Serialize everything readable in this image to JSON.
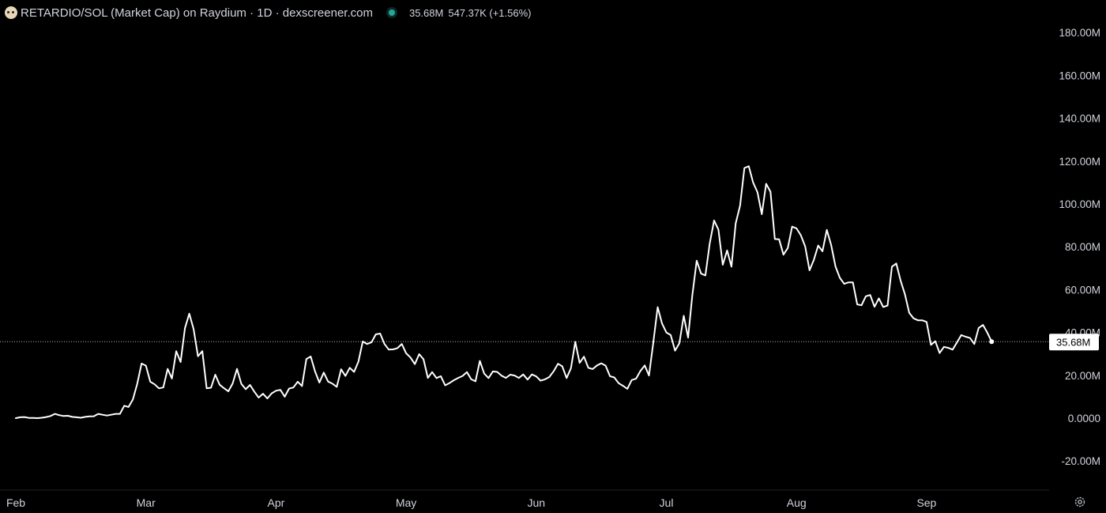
{
  "header": {
    "title": "RETARDIO/SOL (Market Cap) on Raydium · 1D · dexscreener.com",
    "value": "35.68M",
    "change": "547.37K (+1.56%)",
    "status_color": "#26a69a"
  },
  "icons": [
    "token-logo-icon",
    "status-dot-icon",
    "settings-gear-icon"
  ],
  "chart_data": {
    "type": "line",
    "series_color": "#ffffff",
    "background": "#000000",
    "ylim": [
      -20,
      180
    ],
    "y_ticks": [
      "180.00M",
      "160.00M",
      "140.00M",
      "120.00M",
      "100.00M",
      "80.00M",
      "60.00M",
      "40.00M",
      "20.00M",
      "0.0000",
      "-20.00M"
    ],
    "y_tick_values": [
      180,
      160,
      140,
      120,
      100,
      80,
      60,
      40,
      20,
      0,
      -20
    ],
    "x_ticks": [
      "Feb",
      "Mar",
      "Apr",
      "May",
      "Jun",
      "Jul",
      "Aug",
      "Sep"
    ],
    "x_tick_day_index": [
      0,
      30,
      60,
      90,
      120,
      150,
      180,
      210
    ],
    "first_date": "Feb 1",
    "grid": false,
    "last_value": 35.68,
    "last_value_label": "35.68M",
    "values": [
      0,
      0.4,
      0.5,
      0.1,
      0.1,
      0,
      0.2,
      0.5,
      1,
      2,
      1.4,
      1,
      1.1,
      0.6,
      0.4,
      0.2,
      0.6,
      0.8,
      0.9,
      2,
      1.6,
      1.2,
      1.6,
      2,
      2,
      5.8,
      5.2,
      8.7,
      16,
      25.5,
      24.5,
      17,
      15.8,
      13.9,
      14.3,
      23,
      18.5,
      31.3,
      26.2,
      42,
      48.8,
      41.5,
      28.9,
      31.3,
      13.9,
      14.2,
      20.3,
      15.6,
      14,
      12.5,
      16.2,
      23,
      16,
      13.5,
      15.5,
      12.4,
      9.6,
      11.4,
      9.2,
      11.6,
      12.8,
      13.2,
      10,
      13.8,
      14.3,
      17,
      15,
      27.6,
      28.8,
      21.8,
      16.6,
      21.3,
      17.1,
      16.1,
      14.6,
      22.8,
      19.7,
      23.5,
      21.6,
      26.4,
      35.8,
      34.6,
      35.4,
      39.1,
      39.5,
      34.6,
      32,
      32.1,
      32.7,
      34.6,
      30.3,
      28.3,
      25.2,
      29.9,
      27.5,
      18.8,
      21.5,
      18.7,
      19.6,
      15.3,
      16.4,
      17.7,
      18.8,
      19.7,
      21.5,
      18.1,
      17.2,
      26.7,
      20.8,
      18.7,
      21.8,
      21.6,
      19.8,
      18.8,
      20.3,
      19.9,
      18.8,
      20.4,
      18,
      20.4,
      19.5,
      17.5,
      18.1,
      19.2,
      21.9,
      25.4,
      24.2,
      18.7,
      23.3,
      35.6,
      25.8,
      28.7,
      23.5,
      22.9,
      24.6,
      25.6,
      24.5,
      19.6,
      19,
      16.3,
      15.1,
      13.7,
      17.8,
      18.4,
      22,
      24.6,
      19.9,
      35.4,
      51.8,
      44.2,
      40,
      38.8,
      31.5,
      35,
      47.8,
      37.6,
      57.5,
      73.5,
      67.5,
      66.6,
      81.6,
      92.3,
      88,
      71.6,
      78.3,
      70.7,
      91,
      99.2,
      116.8,
      117.6,
      110,
      105.5,
      95.2,
      109.4,
      105.7,
      83.6,
      83.5,
      76.3,
      79.4,
      89.4,
      88.6,
      85.4,
      80.2,
      69,
      73.9,
      80.6,
      77.9,
      87.9,
      80.8,
      70.8,
      65.5,
      62.7,
      63.4,
      63.4,
      53.1,
      52.7,
      56.9,
      57.5,
      52,
      55.9,
      51.9,
      52.6,
      70.7,
      72.2,
      64.2,
      57.8,
      49.2,
      46.6,
      45.7,
      45.7,
      44.9,
      34.2,
      35.9,
      30.4,
      33.3,
      32.8,
      32,
      35.3,
      38.8,
      38,
      37.4,
      34.6,
      42.1,
      43.5,
      39.9,
      35.7
    ]
  }
}
